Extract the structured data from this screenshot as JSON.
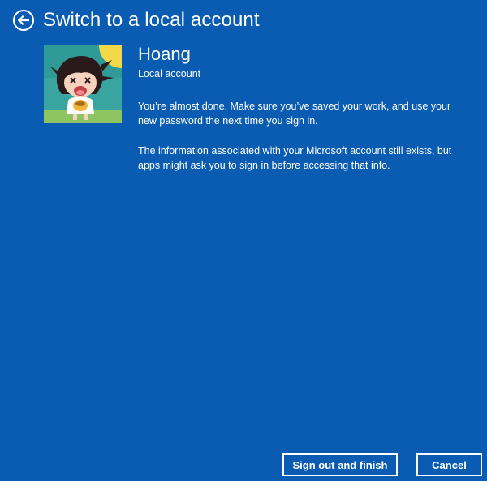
{
  "header": {
    "back_icon": "back-arrow-circle-icon",
    "title": "Switch to a local account"
  },
  "user": {
    "avatar_icon": "user-avatar-cartoon-girl",
    "name": "Hoang",
    "account_type": "Local account"
  },
  "messages": {
    "line1": "You’re almost done. Make sure you’ve saved your work, and use your new password the next time you sign in.",
    "line2": "The information associated with your Microsoft account still exists, but apps might ask you to sign in before accessing that info."
  },
  "buttons": {
    "finish_label": "Sign out and finish",
    "cancel_label": "Cancel"
  },
  "colors": {
    "background": "#0a5cb2",
    "text": "#ffffff"
  }
}
